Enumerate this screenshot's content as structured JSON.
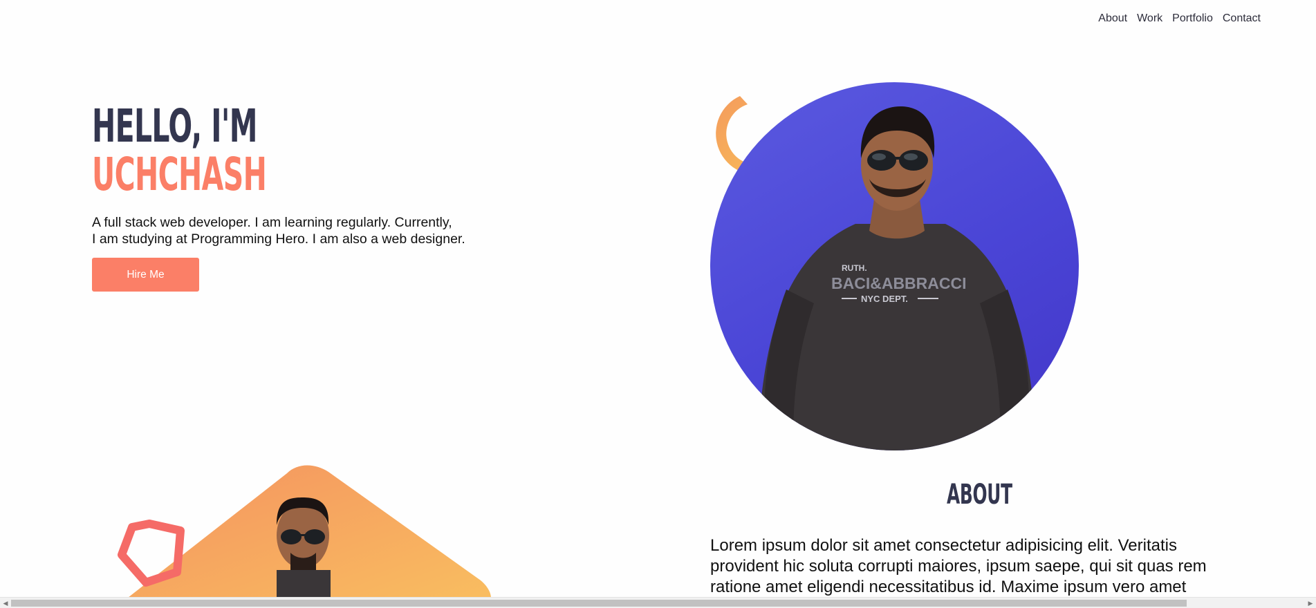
{
  "nav": {
    "items": [
      "About",
      "Work",
      "Portfolio",
      "Contact"
    ]
  },
  "hero": {
    "greeting": "HELLO, I'M",
    "name": "UCHCHASH",
    "description_line1": "A full stack web developer. I am learning regularly. Currently,",
    "description_line2": "I am studying at Programming Hero. I am also a web designer.",
    "button_label": "Hire Me"
  },
  "portrait": {
    "shirt_text_1": "RUTH.",
    "shirt_text_2": "BACI&ABBRACCI",
    "shirt_text_3": "NYC DEPT."
  },
  "about": {
    "heading": "ABOUT",
    "text_line1": "Lorem ipsum dolor sit amet consectetur adipisicing elit. Veritatis",
    "text_line2": "provident hic soluta corrupti maiores, ipsum saepe, qui sit quas rem",
    "text_line3": "ratione amet eligendi necessitatibus id. Maxime ipsum vero amet"
  },
  "colors": {
    "accent": "#fb7f67",
    "heading_dark": "#33364f",
    "portrait_bg": "#4a45d6",
    "arc_gradient_start": "#f49b5c",
    "arc_gradient_end": "#f9c25a"
  },
  "icons": {
    "scroll_left": "scroll-left-arrow-icon",
    "scroll_right": "scroll-right-arrow-icon"
  }
}
